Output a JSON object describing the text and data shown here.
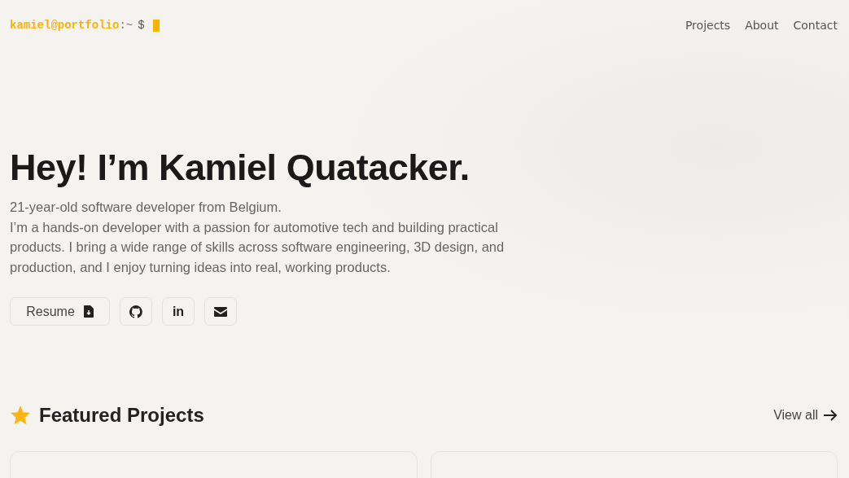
{
  "prompt": {
    "user_host": "kamiel@portfolio",
    "path": ":~",
    "symbol": "$"
  },
  "nav": [
    "Projects",
    "About",
    "Contact"
  ],
  "hero": {
    "title": "Hey! I’m Kamiel Quatacker.",
    "lines": [
      "21-year-old software developer from Belgium.",
      "I’m a hands-on developer with a passion for automotive tech and building practical products. I bring a wide range of skills across software engineering, 3D design, and production, and I enjoy turning ideas into real, working products."
    ]
  },
  "actions": {
    "resume": "Resume",
    "linkedin": "in"
  },
  "featured": {
    "title": "Featured Projects",
    "link": "View all"
  }
}
